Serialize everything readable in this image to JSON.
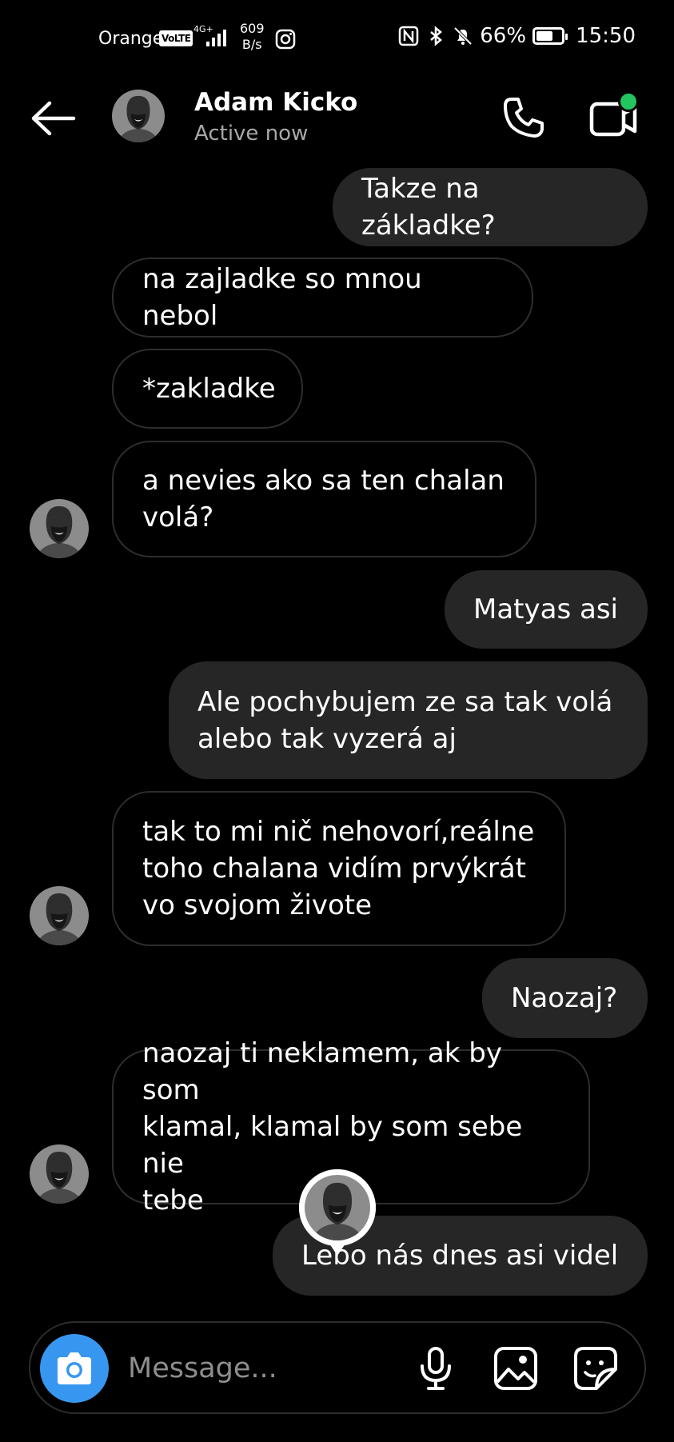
{
  "status_bar": {
    "carrier": "Orange",
    "volte": "VoLTE",
    "network": "4G+",
    "speed_value": "609",
    "speed_unit": "B/s",
    "battery": "66%",
    "battery_level": 0.66,
    "time": "15:50"
  },
  "header": {
    "name": "Adam Kicko",
    "status": "Active now"
  },
  "messages": [
    {
      "side": "out",
      "text": "Takze na základke?"
    },
    {
      "side": "in",
      "text": "na zajladke so mnou nebol"
    },
    {
      "side": "in",
      "text": "*zakladke"
    },
    {
      "side": "in",
      "text": "a nevies ako sa ten chalan\nvolá?"
    },
    {
      "side": "out",
      "text": "Matyas asi"
    },
    {
      "side": "out",
      "text": "Ale pochybujem ze sa tak volá\nalebo tak vyzerá aj"
    },
    {
      "side": "in",
      "text": "tak to mi nič nehovorí,reálne\ntoho chalana vidím prvýkrát\nvo svojom živote"
    },
    {
      "side": "out",
      "text": "Naozaj?"
    },
    {
      "side": "in",
      "text": "naozaj ti neklamem, ak by som\nklamal, klamal by som sebe nie\ntebe"
    },
    {
      "side": "out",
      "text": "Lebo nás dnes asi videl"
    }
  ],
  "composer": {
    "placeholder": "Message..."
  },
  "colors": {
    "background": "#000000",
    "outgoing_bubble": "#262626",
    "incoming_border": "#2d2d2d",
    "camera_button": "#3797f0",
    "active_dot": "#22c55e",
    "secondary_text": "#a8a8a8"
  }
}
